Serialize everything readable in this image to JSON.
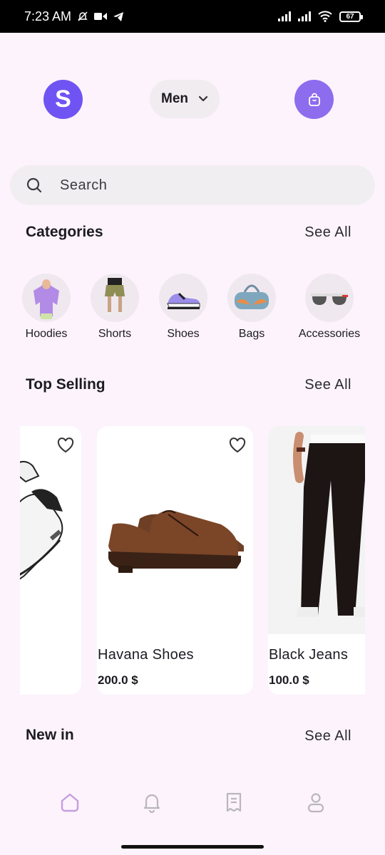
{
  "status_bar": {
    "time": "7:23 AM",
    "battery": "67"
  },
  "header": {
    "avatar_initial": "S",
    "gender": "Men"
  },
  "search": {
    "placeholder": "Search"
  },
  "categories": {
    "title": "Categories",
    "see_all": "See All",
    "items": [
      {
        "label": "Hoodies",
        "icon": "hoodie-image"
      },
      {
        "label": "Shorts",
        "icon": "shorts-image"
      },
      {
        "label": "Shoes",
        "icon": "sneaker-image"
      },
      {
        "label": "Bags",
        "icon": "duffel-bag-image"
      },
      {
        "label": "Accessories",
        "icon": "sunglasses-image"
      }
    ]
  },
  "top_selling": {
    "title": "Top Selling",
    "see_all": "See All",
    "products": [
      {
        "name": "",
        "price": "",
        "image": "white-sneakers-image"
      },
      {
        "name": "Havana Shoes",
        "price": "200.0 $",
        "image": "brown-shoes-image"
      },
      {
        "name": "Black Jeans",
        "price": "100.0 $",
        "image": "black-jeans-image"
      }
    ]
  },
  "new_in": {
    "title": "New in",
    "see_all": "See All"
  },
  "nav": {
    "items": [
      "home-icon",
      "notification-icon",
      "orders-icon",
      "profile-icon"
    ]
  },
  "colors": {
    "accent": "#8e6cee",
    "avatar": "#6f54f3",
    "background": "#fdf3fc"
  }
}
